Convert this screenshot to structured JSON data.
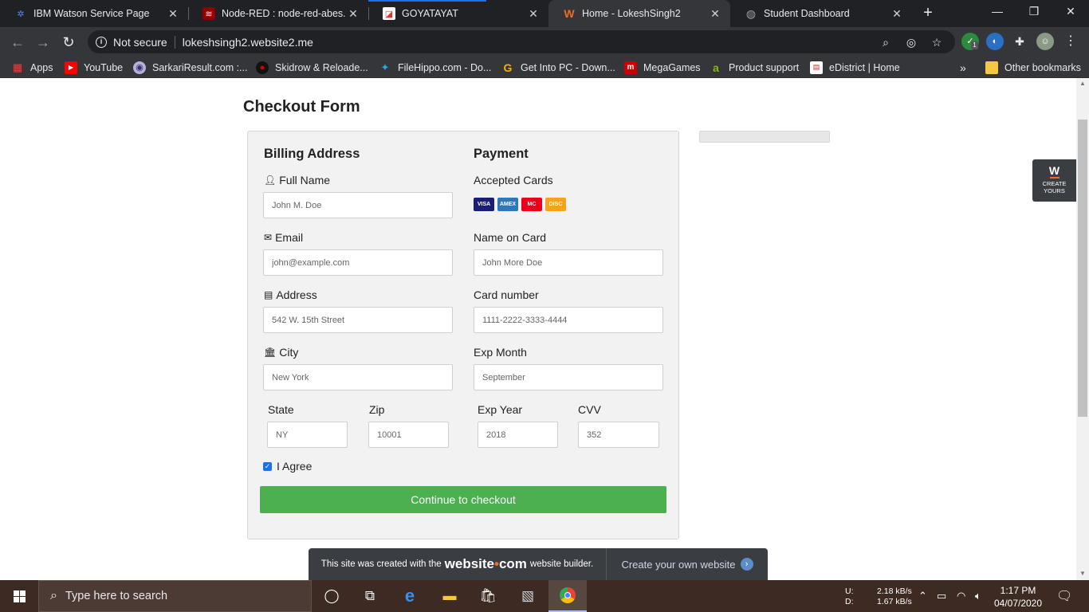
{
  "browser": {
    "tabs": [
      {
        "title": "IBM Watson Service Page",
        "icon": "ibm-watson-icon",
        "color": "#4589ff"
      },
      {
        "title": "Node-RED : node-red-abes.eu",
        "icon": "node-red-icon",
        "color": "#8f0000"
      },
      {
        "title": "GOYATAYAT",
        "icon": "goyatayat-icon",
        "color": "#d43b2f"
      },
      {
        "title": "Home - LokeshSingh2",
        "icon": "website-w-icon",
        "color": "#f26b21"
      },
      {
        "title": "Student Dashboard",
        "icon": "globe-icon",
        "color": "#9aa0a6"
      }
    ],
    "new_tab": "+",
    "security_label": "Not secure",
    "url": "lokeshsingh2.website2.me",
    "extension_badge": "1"
  },
  "bookmarks": {
    "items": [
      {
        "label": "Apps",
        "icon": "apps-grid-icon"
      },
      {
        "label": "YouTube",
        "icon": "youtube-icon"
      },
      {
        "label": "SarkariResult.com :...",
        "icon": "sarkariresult-icon"
      },
      {
        "label": "Skidrow & Reloade...",
        "icon": "skidrow-icon"
      },
      {
        "label": "FileHippo.com - Do...",
        "icon": "filehippo-icon"
      },
      {
        "label": "Get Into PC - Down...",
        "icon": "getintopc-icon"
      },
      {
        "label": "MegaGames",
        "icon": "megagames-icon"
      },
      {
        "label": "Product support",
        "icon": "acer-icon"
      },
      {
        "label": "eDistrict | Home",
        "icon": "edistrict-icon"
      }
    ],
    "overflow": "»",
    "other": "Other bookmarks"
  },
  "page": {
    "heading": "Checkout Form",
    "billing": {
      "title": "Billing Address",
      "full_name_label": "Full Name",
      "full_name_placeholder": "John M. Doe",
      "email_label": "Email",
      "email_placeholder": "john@example.com",
      "address_label": "Address",
      "address_placeholder": "542 W. 15th Street",
      "city_label": "City",
      "city_placeholder": "New York",
      "state_label": "State",
      "state_placeholder": "NY",
      "zip_label": "Zip",
      "zip_placeholder": "10001"
    },
    "payment": {
      "title": "Payment",
      "accepted_label": "Accepted Cards",
      "cards": [
        {
          "name": "VISA",
          "color": "#1a1f71"
        },
        {
          "name": "AMEX",
          "color": "#2e77bb"
        },
        {
          "name": "MC",
          "color": "#eb001b"
        },
        {
          "name": "DISC",
          "color": "#f7a21b"
        }
      ],
      "name_label": "Name on Card",
      "name_placeholder": "John More Doe",
      "card_label": "Card number",
      "card_placeholder": "1111-2222-3333-4444",
      "exp_month_label": "Exp Month",
      "exp_month_placeholder": "September",
      "exp_year_label": "Exp Year",
      "exp_year_placeholder": "2018",
      "cvv_label": "CVV",
      "cvv_placeholder": "352"
    },
    "agree_label": "I Agree",
    "agree_checked": true,
    "submit_label": "Continue to checkout",
    "submit_color": "#4caf50",
    "badge": {
      "mark": "W",
      "text_line1": "CREATE",
      "text_line2": "YOURS"
    },
    "promo": {
      "prefix": "This site was created with the",
      "brand_a": "website",
      "brand_dot": "•",
      "brand_b": "com",
      "suffix": "website builder.",
      "cta": "Create your own website"
    }
  },
  "taskbar": {
    "search_placeholder": "Type here to search",
    "net_upload_label": "U:",
    "net_download_label": "D:",
    "net_upload": "2.18 kB/s",
    "net_download": "1.67 kB/s",
    "time": "1:17 PM",
    "date": "04/07/2020"
  }
}
